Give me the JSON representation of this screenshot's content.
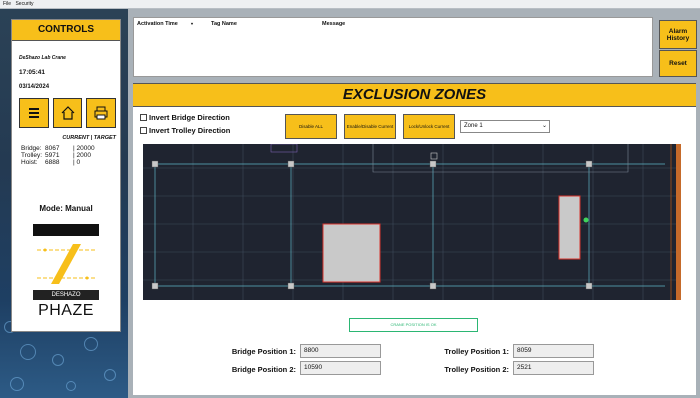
{
  "menubar": {
    "items": [
      "File",
      "Security"
    ]
  },
  "controls": {
    "title": "CONTROLS",
    "location": "DeShazo Lab Crane",
    "time": "17:05:41",
    "date": "03/14/2024",
    "current_target_header": "CURRENT | TARGET",
    "rows": [
      {
        "label": "Bridge:",
        "current": "8067",
        "target": "| 20000"
      },
      {
        "label": "Trolley:",
        "current": "5971",
        "target": "| 2000"
      },
      {
        "label": "Hoist:",
        "current": "6888",
        "target": "| 0"
      }
    ],
    "mode": "Mode: Manual",
    "logo_deshazo": "DESHAZO",
    "logo_phaze": "PHAZE"
  },
  "alarm": {
    "columns": [
      "Activation Time",
      "Tag Name",
      "Message"
    ],
    "history_label": "Alarm History",
    "reset_label": "Reset"
  },
  "exclusion": {
    "title": "EXCLUSION ZONES",
    "invert_bridge": "Invert Bridge Direction",
    "invert_trolley": "Invert Trolley Direction",
    "enable_all": "Disable ALL",
    "enable_current": "Enable/Disable Current",
    "lock_current": "Lock/Unlock Current",
    "zone_select": "Zone 1",
    "status": "CRANE POSITION IS OK",
    "bridge_pos_1_label": "Bridge Position 1:",
    "bridge_pos_1": "8800",
    "bridge_pos_2_label": "Bridge Position 2:",
    "bridge_pos_2": "10590",
    "trolley_pos_1_label": "Trolley Position 1:",
    "trolley_pos_1": "8059",
    "trolley_pos_2_label": "Trolley Position 2:",
    "trolley_pos_2": "2521"
  },
  "colors": {
    "accent": "#f7bf1a",
    "map_bg": "#1f2430",
    "zone_border": "#d9342b",
    "status_ok": "#2bb673"
  }
}
